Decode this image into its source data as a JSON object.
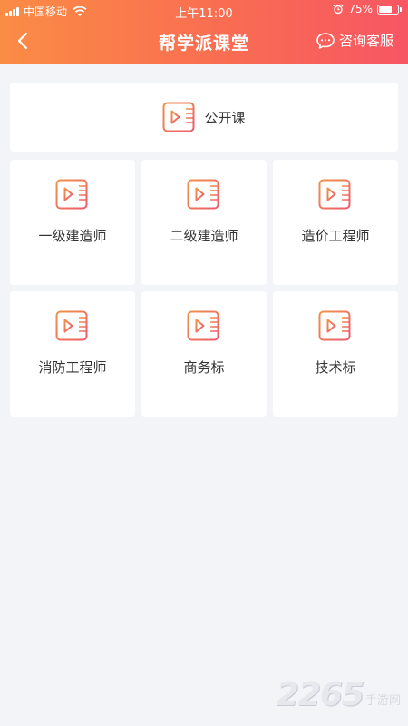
{
  "status_bar": {
    "carrier": "中国移动",
    "time": "上午11:00",
    "battery_percent": "75%",
    "battery_level": 0.75
  },
  "nav": {
    "title": "帮学派课堂",
    "service_label": "咨询客服",
    "back_icon": "chevron-left-icon"
  },
  "featured": {
    "label": "公开课",
    "icon": "video-play-icon"
  },
  "courses": [
    {
      "label": "一级建造师",
      "icon": "video-play-icon"
    },
    {
      "label": "二级建造师",
      "icon": "video-play-icon"
    },
    {
      "label": "造价工程师",
      "icon": "video-play-icon"
    },
    {
      "label": "消防工程师",
      "icon": "video-play-icon"
    },
    {
      "label": "商务标",
      "icon": "video-play-icon"
    },
    {
      "label": "技术标",
      "icon": "video-play-icon"
    }
  ],
  "watermark": {
    "number": "2265",
    "text": "手游网"
  },
  "colors": {
    "header_start": "#fb8c45",
    "header_end": "#f75663",
    "background": "#f3f4f8",
    "icon_start": "#f0924a",
    "icon_end": "#ee5a6c"
  }
}
